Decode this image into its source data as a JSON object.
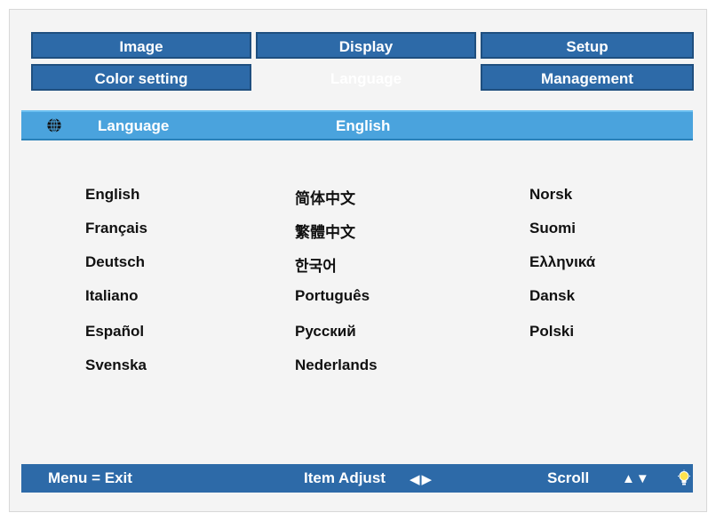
{
  "tabs": {
    "row1": [
      "Image",
      "Display",
      "Setup"
    ],
    "row2": [
      "Color setting",
      "Language",
      "Management"
    ]
  },
  "language_bar": {
    "label": "Language",
    "value": "English"
  },
  "languages": {
    "col1": [
      "English",
      "Français",
      "Deutsch",
      "Italiano",
      "Español",
      "Svenska"
    ],
    "col2": [
      "简体中文",
      "繁體中文",
      "한국어",
      "Português",
      "Русский",
      "Nederlands"
    ],
    "col3": [
      "Norsk",
      "Suomi",
      "Ελληνικά",
      "Dansk",
      "Polski"
    ]
  },
  "footer": {
    "menu": "Menu = Exit",
    "item_adjust": "Item Adjust",
    "lr_arrows": "◀▶",
    "scroll": "Scroll",
    "ud_arrows": "▲▼"
  },
  "colors": {
    "tab_blue": "#2d6aa8",
    "highlight_blue": "#4aa3dd",
    "panel_bg": "#f4f4f4"
  },
  "icons": {
    "language": "globe-icon",
    "help": "lightbulb-icon"
  }
}
